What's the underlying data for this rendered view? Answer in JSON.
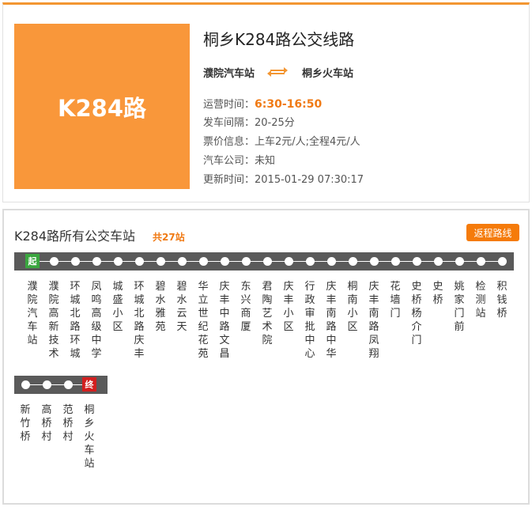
{
  "route": {
    "badge": "K284路",
    "title": "桐乡K284路公交线路",
    "from": "濮院汽车站",
    "to": "桐乡火车站",
    "swap_icon": "swap-arrows-icon"
  },
  "info": {
    "hours_label": "运营时间：",
    "hours_value": "6:30-16:50",
    "interval": "发车间隔：20-25分",
    "fare": "票价信息：上车2元/人;全程4元/人",
    "company": "汽车公司：未知",
    "updated": "更新时间：2015-01-29 07:30:17"
  },
  "stations": {
    "title": "K284路所有公交车站",
    "count": "共27站",
    "return_button": "返程路线",
    "start_badge": "起",
    "end_badge": "终",
    "row1": [
      "濮院汽车站",
      "濮院高新技术",
      "环城北路环城",
      "凤鸣高级中学",
      "城盛小区",
      "环城北路庆丰",
      "碧水雅苑",
      "碧水云天",
      "华立世纪花苑",
      "庆丰中路文昌",
      "东兴商厦",
      "君陶艺术院",
      "庆丰小区",
      "行政审批中心",
      "庆丰南路中华",
      "桐南小区",
      "庆丰南路凤翔",
      "花墙门",
      "史桥杨介门",
      "史桥",
      "姚家门前",
      "检测站",
      "积钱桥"
    ],
    "row2": [
      "新竹桥",
      "高桥村",
      "范桥村",
      "桐乡火车站"
    ]
  },
  "colors": {
    "accent": "#f39632",
    "badge_bg": "#f9973a",
    "highlight": "#f07a14",
    "track": "#5a5a5a",
    "start": "#3aa63f",
    "end": "#d21f1f"
  }
}
